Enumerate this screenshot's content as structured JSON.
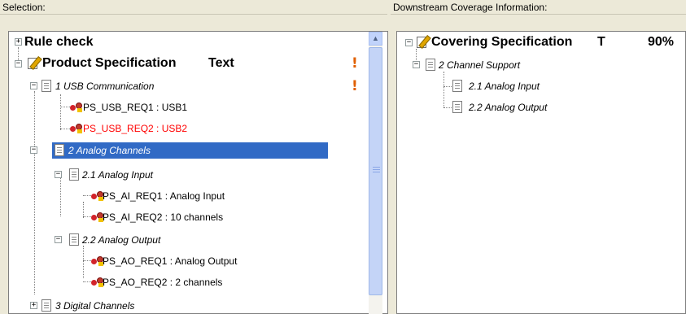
{
  "left_pane": {
    "title": "Selection:",
    "tree": {
      "rule_check": "Rule check",
      "product_spec": "Product Specification",
      "product_spec_type": "Text",
      "usb_comm": "1 USB Communication",
      "req_usb1": "PS_USB_REQ1 : USB1",
      "req_usb2": "PS_USB_REQ2 : USB2",
      "analog_channels": "2 Analog Channels",
      "analog_input": "2.1 Analog Input",
      "req_ai1": "PS_AI_REQ1 : Analog Input",
      "req_ai2": "PS_AI_REQ2 : 10 channels",
      "analog_output": "2.2 Analog Output",
      "req_ao1": "PS_AO_REQ1 : Analog Output",
      "req_ao2": "PS_AO_REQ2 : 2 channels",
      "digital_channels": "3 Digital Channels"
    }
  },
  "right_pane": {
    "title": "Downstream Coverage Information:",
    "tree": {
      "covering_spec": "Covering Specification",
      "type_col": "T",
      "percent": "90%",
      "channel_support": "2 Channel Support",
      "analog_input": "2.1 Analog Input",
      "analog_output": "2.2 Analog Output"
    }
  },
  "colors": {
    "selection": "#316ac5",
    "warning": "#e06000",
    "error_text": "#ff0000"
  },
  "icons": [
    "plus-icon",
    "minus-icon",
    "document-icon",
    "specification-icon",
    "requirement-icon",
    "warning-icon",
    "scroll-up-arrow-icon"
  ]
}
